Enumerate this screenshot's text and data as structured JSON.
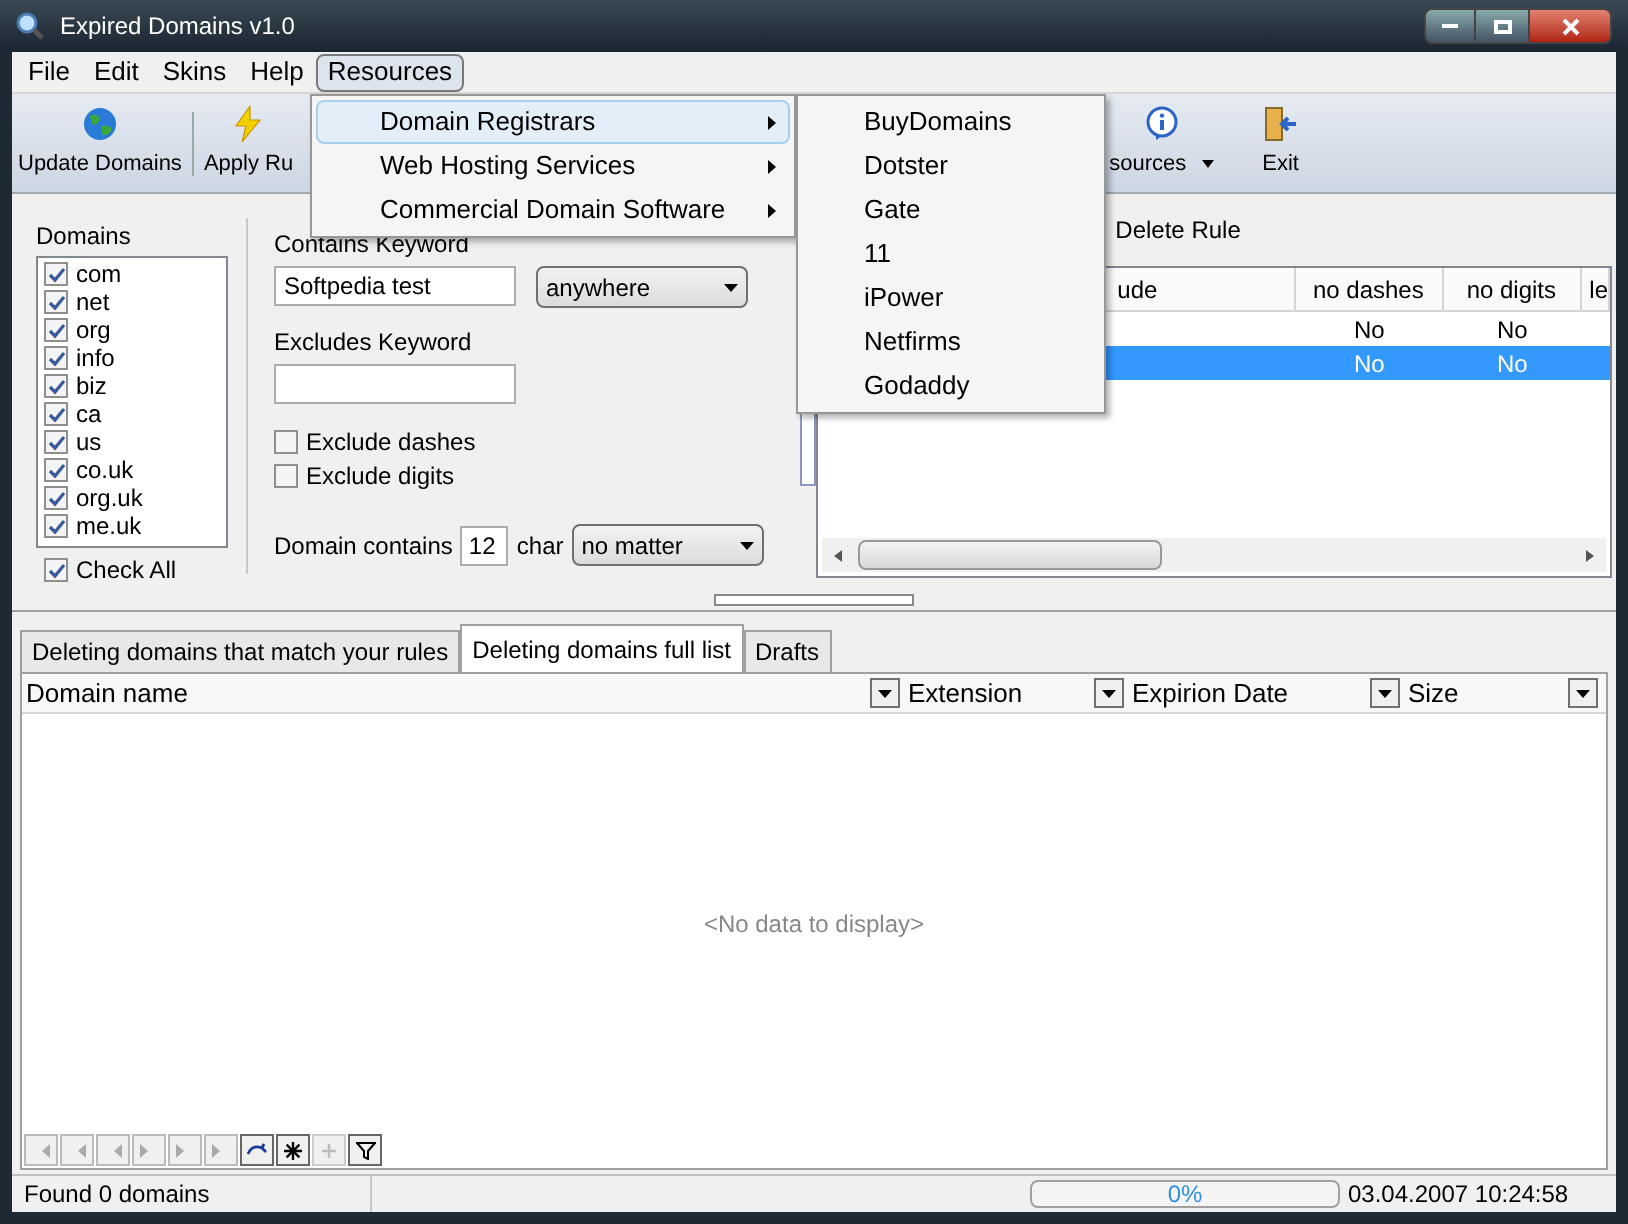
{
  "window": {
    "title": "Expired Domains v1.0"
  },
  "menu_bar": [
    {
      "label": "File",
      "selected": false
    },
    {
      "label": "Edit",
      "selected": false
    },
    {
      "label": "Skins",
      "selected": false
    },
    {
      "label": "Help",
      "selected": false
    },
    {
      "label": "Resources",
      "selected": true
    }
  ],
  "resources_menu": [
    {
      "label": "Domain Registrars",
      "selected": true
    },
    {
      "label": "Web Hosting Services",
      "selected": false
    },
    {
      "label": "Commercial Domain Software",
      "selected": false
    }
  ],
  "registrars_submenu": [
    "BuyDomains",
    "Dotster",
    "Gate",
    "11",
    "iPower",
    "Netfirms",
    "Godaddy"
  ],
  "toolbar": [
    {
      "label": "Update Domains",
      "kind": "globe",
      "dropdown": false
    },
    {
      "label": "Apply Ru",
      "kind": "bolt",
      "dropdown": false
    },
    {
      "label": "sources",
      "kind": "info",
      "dropdown": true
    },
    {
      "label": "Exit",
      "kind": "exit",
      "dropdown": false
    }
  ],
  "domains": {
    "label": "Domains",
    "items": [
      {
        "label": "com",
        "checked": true
      },
      {
        "label": "net",
        "checked": true
      },
      {
        "label": "org",
        "checked": true
      },
      {
        "label": "info",
        "checked": true
      },
      {
        "label": "biz",
        "checked": true
      },
      {
        "label": "ca",
        "checked": true
      },
      {
        "label": "us",
        "checked": true
      },
      {
        "label": "co.uk",
        "checked": true
      },
      {
        "label": "org.uk",
        "checked": true
      },
      {
        "label": "me.uk",
        "checked": true
      }
    ],
    "check_all": {
      "label": "Check All",
      "checked": true
    }
  },
  "filters": {
    "contains_label": "Contains Keyword",
    "contains_value": "Softpedia test",
    "position": "anywhere",
    "excludes_label": "Excludes Keyword",
    "exclude_dashes": {
      "label": "Exclude dashes",
      "checked": false
    },
    "exclude_digits": {
      "label": "Exclude digits",
      "checked": false
    },
    "length_label": "Domain contains",
    "length_value": "12",
    "char_label": "char",
    "length_mode": "no matter"
  },
  "rules": {
    "delete_button": "Delete Rule",
    "columns": [
      "ude",
      "no dashes",
      "no digits",
      "le"
    ],
    "rows": [
      {
        "no_dashes": "No",
        "no_digits": "No",
        "selected": false
      },
      {
        "no_dashes": "No",
        "no_digits": "No",
        "selected": true
      }
    ]
  },
  "tabs": [
    {
      "label": "Deleting domains that match your rules",
      "selected": false
    },
    {
      "label": "Deleting domains full list",
      "selected": true
    },
    {
      "label": "Drafts",
      "selected": false
    }
  ],
  "list": {
    "columns": [
      "Domain name",
      "Extension",
      "Expirion Date",
      "Size"
    ],
    "empty_text": "<No data to display>"
  },
  "status_bar": {
    "message": "Found 0 domains",
    "progress": {
      "level": 0,
      "reading": "0%"
    },
    "datetime": "03.04.2007 10:24:58"
  }
}
